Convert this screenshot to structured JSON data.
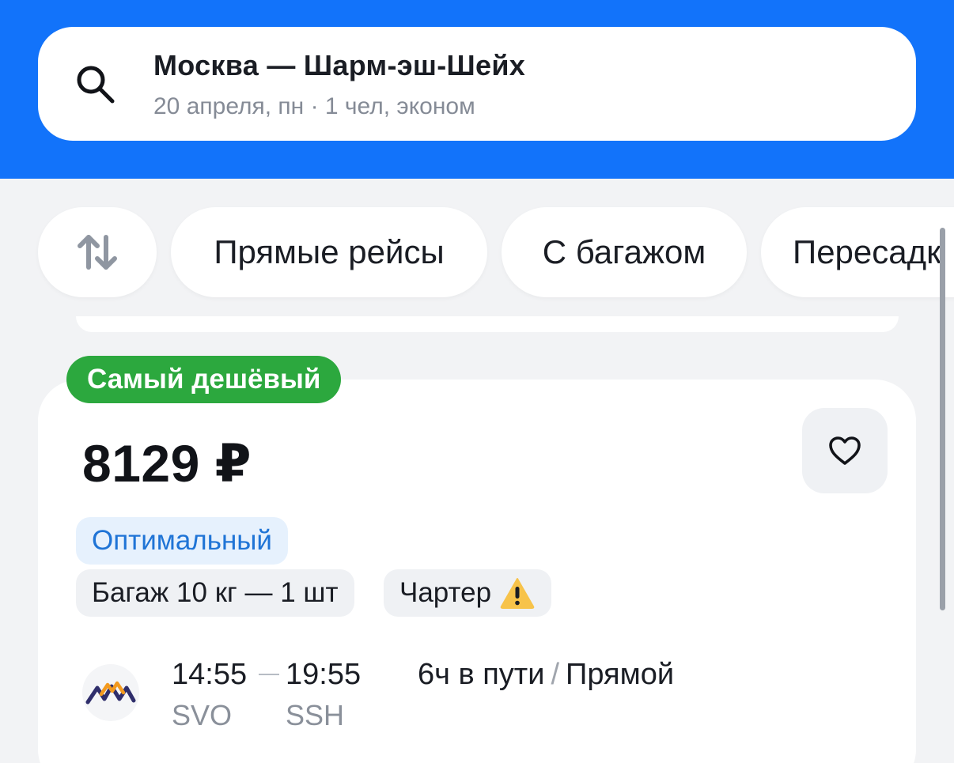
{
  "search": {
    "route": "Москва — Шарм-эш-Шейх",
    "details": "20 апреля, пн · 1 чел, эконом",
    "icon": "search-icon"
  },
  "filters": {
    "sort_icon": "sort-arrows-icon",
    "items": [
      {
        "label": "Прямые рейсы"
      },
      {
        "label": "С багажом"
      },
      {
        "label": "Пересадк"
      }
    ]
  },
  "offer": {
    "badge": "Самый дешёвый",
    "price": "8129 ₽",
    "favorite_icon": "heart-icon",
    "fare_tag": "Оптимальный",
    "baggage_tag": "Багаж 10 кг — 1 шт",
    "charter_tag": "Чартер",
    "charter_icon": "warning-icon",
    "airline_logo": "airline-logo",
    "departure_time": "14:55",
    "arrival_time": "19:55",
    "departure_airport": "SVO",
    "arrival_airport": "SSH",
    "duration": "6ч в пути",
    "separator": "/",
    "flight_type": "Прямой"
  },
  "colors": {
    "brand_blue": "#1273fa",
    "badge_green": "#2ca83e",
    "fare_blue": "#1f74d6",
    "warning_yellow": "#f7c34a"
  }
}
